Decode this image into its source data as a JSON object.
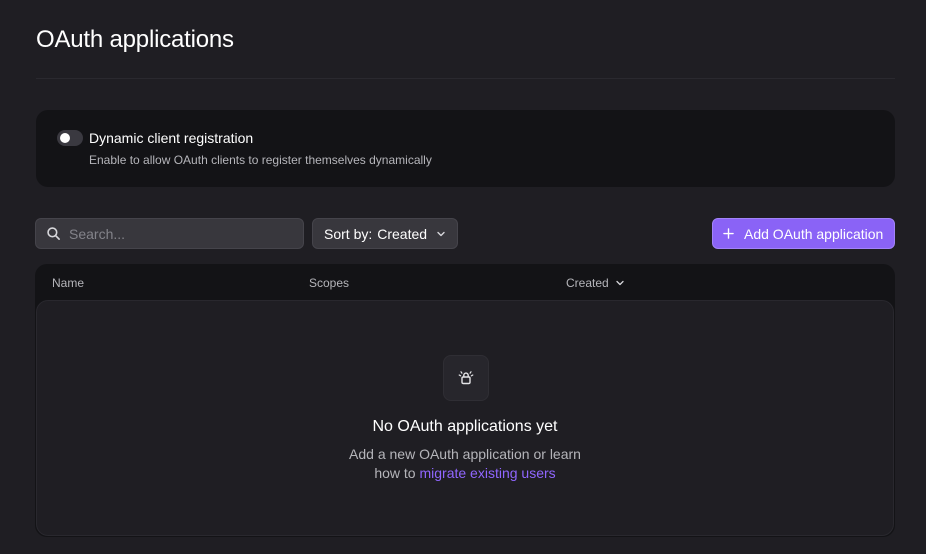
{
  "page": {
    "title": "OAuth applications"
  },
  "dynamic_registration": {
    "title": "Dynamic client registration",
    "description": "Enable to allow OAuth clients to register themselves dynamically",
    "enabled": false
  },
  "toolbar": {
    "search_placeholder": "Search...",
    "sort_label": "Sort by:",
    "sort_value": "Created",
    "add_label": "Add OAuth application"
  },
  "table": {
    "columns": [
      "Name",
      "Scopes",
      "Created"
    ],
    "rows": []
  },
  "empty_state": {
    "title": "No OAuth applications yet",
    "line1": "Add a new OAuth application or learn",
    "line2_prefix": "how to",
    "link_text": "migrate existing users",
    "icon": "lock-icon"
  },
  "colors": {
    "accent": "#8a63f6",
    "link": "#9066ff",
    "background": "#1f1e23",
    "card": "#131316"
  }
}
